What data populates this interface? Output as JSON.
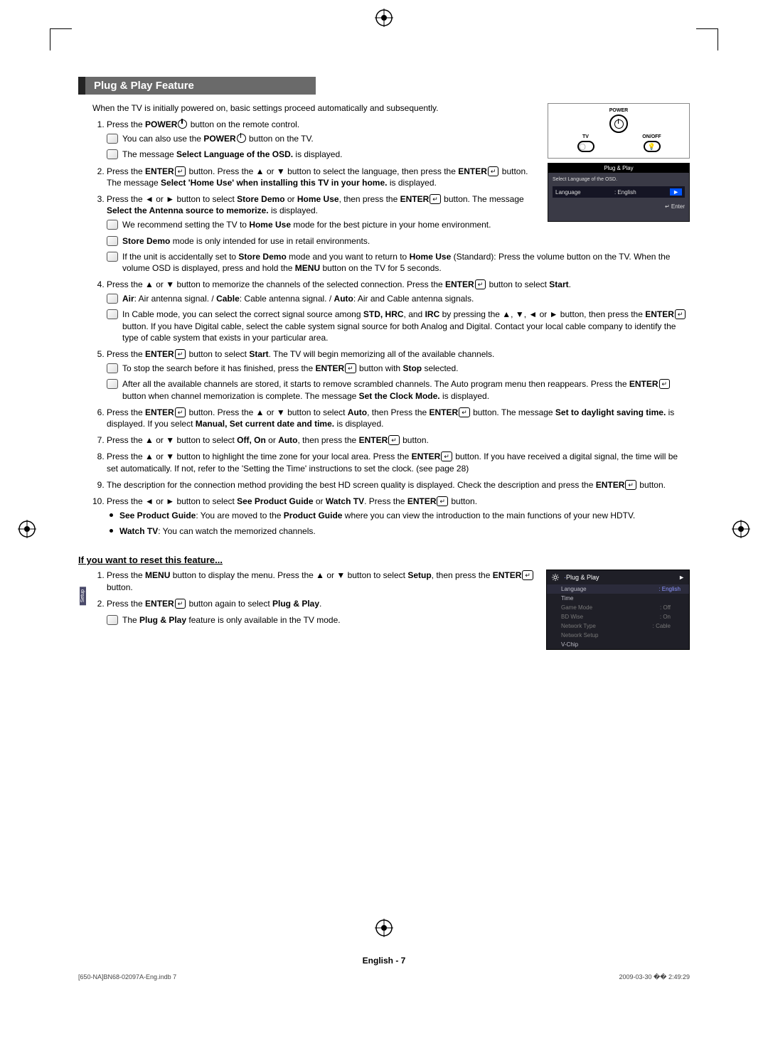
{
  "title": "Plug & Play Feature",
  "intro": "When the TV is initially powered on, basic settings proceed automatically and subsequently.",
  "remote": {
    "power_label": "POWER",
    "tv_label": "TV",
    "onoff_label": "ON/OFF"
  },
  "osd1": {
    "title": "Plug & Play",
    "subtitle": "Select Language of the OSD.",
    "row_key": "Language",
    "row_val": ": English",
    "footer": "↵ Enter"
  },
  "steps": {
    "s1": {
      "lead": "Press the ",
      "b1": "POWER",
      "tail": " button on the remote control."
    },
    "s1n1": {
      "a": "You can also use the ",
      "b1": "POWER",
      "c": " button on the TV."
    },
    "s1n2": {
      "a": "The message ",
      "b1": "Select Language of the OSD.",
      "c": " is displayed."
    },
    "s2": {
      "a": "Press the ",
      "b1": "ENTER",
      "b2": " button. Press the ▲ or ▼ button to select the language, then press the ",
      "b3": "ENTER",
      "b4": " button. The message ",
      "b5": "Select 'Home Use' when installing this TV in your home.",
      "c": " is displayed."
    },
    "s3": {
      "a": "Press the ◄ or ► button to select ",
      "b1": "Store Demo",
      "b2": " or ",
      "b3": "Home Use",
      "b4": ", then press the ",
      "b5": "ENTER",
      "b6": " button. The message ",
      "b7": "Select the Antenna source to memorize.",
      "c": " is displayed."
    },
    "s3n1": {
      "a": "We recommend setting the TV to ",
      "b1": "Home Use",
      "c": " mode for the best picture in your home environment."
    },
    "s3n2": {
      "b1": "Store Demo",
      "c": " mode is only intended for use in retail environments."
    },
    "s3n3": {
      "a": "If the unit is accidentally set to ",
      "b1": "Store Demo",
      "b2": " mode and you want to return to ",
      "b3": "Home Use",
      "b4": " (Standard): Press the volume button on the TV. When the volume OSD is displayed, press and hold the ",
      "b5": "MENU",
      "c": " button on the TV for 5 seconds."
    },
    "s4": {
      "a": "Press the ▲ or ▼ button to memorize the channels of the selected connection. Press the ",
      "b1": "ENTER",
      "b2": " button to select ",
      "b3": "Start",
      "c": "."
    },
    "s4n1": {
      "b1": "Air",
      "a": ": Air antenna signal. / ",
      "b2": "Cable",
      "b": ": Cable antenna signal. / ",
      "b3": "Auto",
      "c": ": Air and Cable antenna signals."
    },
    "s4n2": {
      "a": "In Cable mode, you can select the correct signal source among ",
      "b1": "STD, HRC",
      "b2": ", and ",
      "b3": "IRC",
      "b4": " by pressing the ▲, ▼, ◄ or ► button, then press the ",
      "b5": "ENTER",
      "c": " button. If you have Digital cable, select the cable system signal source for both Analog and Digital. Contact your local cable company to identify the type of cable system that exists in your particular area."
    },
    "s5": {
      "a": "Press the ",
      "b1": "ENTER",
      "b2": " button to select ",
      "b3": "Start",
      "c": ". The TV will begin memorizing all of the available channels."
    },
    "s5n1": {
      "a": "To stop the search before it has finished, press the ",
      "b1": "ENTER",
      "b2": " button with ",
      "b3": "Stop",
      "c": " selected."
    },
    "s5n2": {
      "a": "After all the available channels are stored, it starts to remove scrambled channels. The Auto program menu then reappears. Press the ",
      "b1": "ENTER",
      "b2": " button when channel memorization is complete. The message ",
      "b3": "Set the Clock Mode.",
      "c": " is displayed."
    },
    "s6": {
      "a": "Press the ",
      "b1": "ENTER",
      "b2": " button. Press the ▲ or ▼ button to select ",
      "b3": "Auto",
      "b4": ", then Press the ",
      "b5": "ENTER",
      "b6": " button. The message ",
      "b7": "Set to daylight saving time.",
      "b8": " is displayed. If you select ",
      "b9": "Manual, Set current date and time.",
      "c": " is displayed."
    },
    "s7": {
      "a": "Press the ▲ or ▼ button to select ",
      "b1": "Off, On",
      "b2": " or ",
      "b3": "Auto",
      "b4": ", then press the ",
      "b5": "ENTER",
      "c": " button."
    },
    "s8": {
      "a": "Press the ▲ or ▼ button to highlight the time zone for your local area. Press the ",
      "b1": "ENTER",
      "c": " button. If you have received a digital signal, the time will be set automatically. If not, refer to the 'Setting the Time' instructions to set the clock. (see page 28)"
    },
    "s9": {
      "a": "The description for the connection method providing the best HD screen quality is displayed. Check the description and press the ",
      "b1": "ENTER",
      "c": " button."
    },
    "s10": {
      "a": "Press the ◄ or ► button to select ",
      "b1": "See Product Guide",
      "b2": " or ",
      "b3": "Watch TV",
      "b4": ". Press the ",
      "b5": "ENTER",
      "c": " button."
    },
    "s10b1": {
      "b1": "See Product Guide",
      "a": ": You are moved to the ",
      "b2": "Product Guide",
      "c": " where you can view the introduction to the main functions of your new HDTV."
    },
    "s10b2": {
      "b1": "Watch TV",
      "c": ": You can watch the memorized channels."
    }
  },
  "reset": {
    "title": "If you want to reset this feature...",
    "s1": {
      "a": "Press the ",
      "b1": "MENU",
      "b2": " button to display the menu. Press the ▲ or ▼ button to select ",
      "b3": "Setup",
      "b4": ", then press the ",
      "b5": "ENTER",
      "c": " button."
    },
    "s2": {
      "a": "Press the ",
      "b1": "ENTER",
      "b2": " button again to select ",
      "b3": "Plug & Play",
      "c": "."
    },
    "n1": {
      "a": "The ",
      "b1": "Plug & Play",
      "c": " feature is only available in the TV mode."
    }
  },
  "setupmenu": {
    "side": "Setup",
    "header": "Plug & Play",
    "rows": [
      {
        "k": "Language",
        "v": ": English",
        "dim": false
      },
      {
        "k": "Time",
        "v": "",
        "dim": false
      },
      {
        "k": "Game Mode",
        "v": ": Off",
        "dim": true
      },
      {
        "k": "BD Wise",
        "v": ": On",
        "dim": true
      },
      {
        "k": "Network Type",
        "v": ": Cable",
        "dim": true
      },
      {
        "k": "Network Setup",
        "v": "",
        "dim": true
      },
      {
        "k": "V-Chip",
        "v": "",
        "dim": false
      }
    ]
  },
  "footer": "English - 7",
  "print_left": "[650-NA]BN68-02097A-Eng.indb   7",
  "print_right": "2009-03-30   �� 2:49:29"
}
